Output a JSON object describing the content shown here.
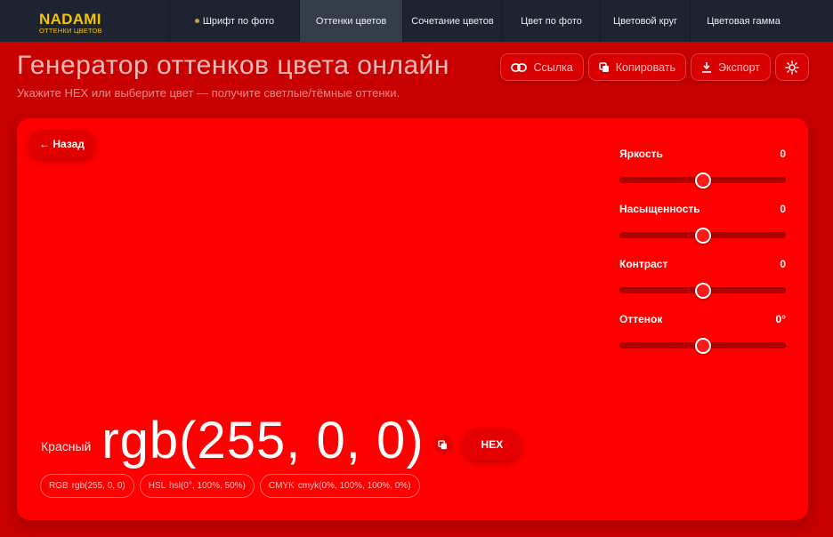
{
  "brand": {
    "name": "NADAMI",
    "subtitle": "ОТТЕНКИ ЦВЕТОВ"
  },
  "nav": {
    "tabs": [
      {
        "label": "Шрифт по фото"
      },
      {
        "label": "Оттенки цветов",
        "active": true
      },
      {
        "label": "Сочетание цветов"
      },
      {
        "label": "Цвет по фото"
      },
      {
        "label": "Цветовой круг"
      },
      {
        "label": "Цветовая гамма"
      }
    ]
  },
  "header": {
    "title": "Генератор оттенков цвета онлайн",
    "subtitle": "Укажите HEX или выберите цвет — получите светлые/тёмные оттенки."
  },
  "actions": {
    "link": "Ссылка",
    "copy": "Копировать",
    "export": "Экспорт"
  },
  "card": {
    "back_label": "← Назад",
    "background": "#ff0000",
    "controls": [
      {
        "label": "Яркость",
        "value": "0",
        "position": 0.5
      },
      {
        "label": "Насыщенность",
        "value": "0",
        "position": 0.5
      },
      {
        "label": "Контраст",
        "value": "0",
        "position": 0.5
      },
      {
        "label": "Оттенок",
        "value": "0°",
        "position": 0.5
      }
    ],
    "color_name": "Красный",
    "color_value": "rgb(255, 0, 0)",
    "format_button": "HEX",
    "chips": [
      {
        "label": "RGB",
        "value": "rgb(255, 0, 0)"
      },
      {
        "label": "HSL",
        "value": "hsl(0°, 100%, 50%)"
      },
      {
        "label": "CMYK",
        "value": "cmyk(0%, 100%, 100%, 0%)"
      }
    ]
  },
  "colors": {
    "nav_bg": "#1d2430",
    "brand_accent": "#f5c400",
    "page_bg": "#c80000"
  }
}
